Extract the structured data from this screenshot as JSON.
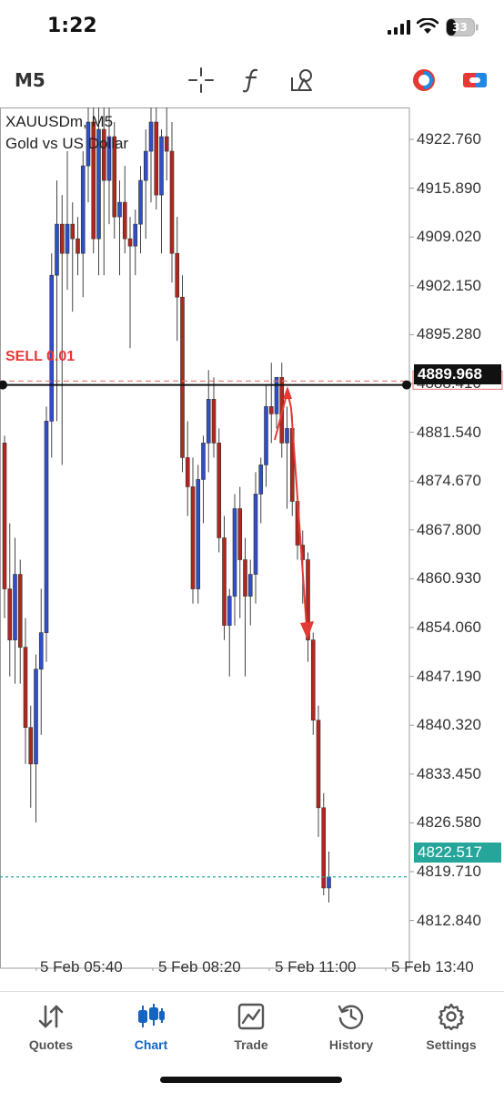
{
  "status_bar": {
    "time": "1:22",
    "battery": "33"
  },
  "toolbar": {
    "timeframe": "M5",
    "icons": [
      "crosshair-icon",
      "function-icon",
      "objects-icon",
      "one-click-trading-icon",
      "trading-toggle-icon"
    ]
  },
  "chart": {
    "symbol": "XAUUSDm, M5",
    "description": "Gold vs US Dollar",
    "sell_order_label": "SELL 0.01",
    "current_price": "4889.968",
    "bid_price": "4822.517",
    "price_axis": [
      "4922.760",
      "4915.890",
      "4909.020",
      "4902.150",
      "4895.280",
      "4888.410",
      "4881.540",
      "4874.670",
      "4867.800",
      "4860.930",
      "4854.060",
      "4847.190",
      "4840.320",
      "4833.450",
      "4826.580",
      "4819.710",
      "4812.840"
    ],
    "time_axis": [
      "5 Feb 05:40",
      "5 Feb 08:20",
      "5 Feb 11:00",
      "5 Feb 13:40"
    ],
    "colors": {
      "bull": "#2f4fc9",
      "bear": "#b3261e",
      "sell_line": "#e57373",
      "bid_line": "#26a69a",
      "annotation": "#e53935"
    }
  },
  "chart_data": {
    "type": "candlestick",
    "title": "XAUUSDm, M5",
    "subtitle": "Gold vs US Dollar",
    "ylim": [
      4810.0,
      4928.0
    ],
    "x_tick_labels": [
      "5 Feb 05:40",
      "5 Feb 08:20",
      "5 Feb 11:00",
      "5 Feb 13:40"
    ],
    "horizontal_lines": [
      {
        "label": "SELL 0.01",
        "value": 4890.5
      },
      {
        "value": 4889.968
      },
      {
        "value": 4822.517
      }
    ],
    "candles": [
      [
        4882,
        4883,
        4858,
        4862
      ],
      [
        4862,
        4871,
        4850,
        4855
      ],
      [
        4855,
        4869,
        4849,
        4864
      ],
      [
        4864,
        4866,
        4849,
        4854
      ],
      [
        4854,
        4858,
        4838,
        4843
      ],
      [
        4843,
        4846,
        4832,
        4838
      ],
      [
        4838,
        4853,
        4830,
        4851
      ],
      [
        4851,
        4862,
        4842,
        4856
      ],
      [
        4856,
        4887,
        4852,
        4885
      ],
      [
        4885,
        4908,
        4880,
        4905
      ],
      [
        4905,
        4918,
        4885,
        4912
      ],
      [
        4912,
        4916,
        4879,
        4908
      ],
      [
        4908,
        4922,
        4903,
        4912
      ],
      [
        4912,
        4915,
        4900,
        4910
      ],
      [
        4910,
        4913,
        4905,
        4908
      ],
      [
        4908,
        4922,
        4902,
        4920
      ],
      [
        4920,
        4928,
        4915,
        4926
      ],
      [
        4926,
        4928,
        4908,
        4910
      ],
      [
        4910,
        4928,
        4905,
        4925
      ],
      [
        4925,
        4928,
        4905,
        4918
      ],
      [
        4918,
        4928,
        4912,
        4924
      ],
      [
        4924,
        4926,
        4910,
        4913
      ],
      [
        4913,
        4918,
        4905,
        4915
      ],
      [
        4915,
        4920,
        4908,
        4910
      ],
      [
        4910,
        4913,
        4895,
        4909
      ],
      [
        4909,
        4914,
        4905,
        4912
      ],
      [
        4912,
        4920,
        4908,
        4918
      ],
      [
        4918,
        4925,
        4910,
        4922
      ],
      [
        4922,
        4928,
        4915,
        4926
      ],
      [
        4926,
        4928,
        4914,
        4916
      ],
      [
        4916,
        4925,
        4908,
        4924
      ],
      [
        4924,
        4928,
        4918,
        4922
      ],
      [
        4922,
        4926,
        4904,
        4908
      ],
      [
        4908,
        4913,
        4896,
        4902
      ],
      [
        4902,
        4905,
        4878,
        4880
      ],
      [
        4880,
        4885,
        4872,
        4876
      ],
      [
        4876,
        4880,
        4860,
        4862
      ],
      [
        4862,
        4879,
        4860,
        4877
      ],
      [
        4877,
        4883,
        4871,
        4882
      ],
      [
        4882,
        4892,
        4878,
        4888
      ],
      [
        4888,
        4891,
        4880,
        4882
      ],
      [
        4882,
        4884,
        4867,
        4869
      ],
      [
        4869,
        4872,
        4855,
        4857
      ],
      [
        4857,
        4862,
        4850,
        4861
      ],
      [
        4861,
        4875,
        4857,
        4873
      ],
      [
        4873,
        4876,
        4858,
        4866
      ],
      [
        4866,
        4869,
        4850,
        4861
      ],
      [
        4861,
        4866,
        4857,
        4864
      ],
      [
        4864,
        4878,
        4860,
        4875
      ],
      [
        4875,
        4880,
        4871,
        4879
      ],
      [
        4879,
        4890,
        4876,
        4887
      ],
      [
        4887,
        4893,
        4882,
        4886
      ],
      [
        4886,
        4891,
        4884,
        4891
      ],
      [
        4891,
        4893,
        4880,
        4882
      ],
      [
        4882,
        4887,
        4873,
        4884
      ],
      [
        4884,
        4886,
        4872,
        4874
      ],
      [
        4874,
        4875,
        4866,
        4868
      ],
      [
        4868,
        4870,
        4860,
        4866
      ],
      [
        4866,
        4867,
        4852,
        4855
      ],
      [
        4855,
        4856,
        4842,
        4844
      ],
      [
        4844,
        4846,
        4828,
        4832
      ],
      [
        4832,
        4834,
        4820,
        4821
      ],
      [
        4821,
        4826,
        4819,
        4822.5
      ]
    ]
  }
}
